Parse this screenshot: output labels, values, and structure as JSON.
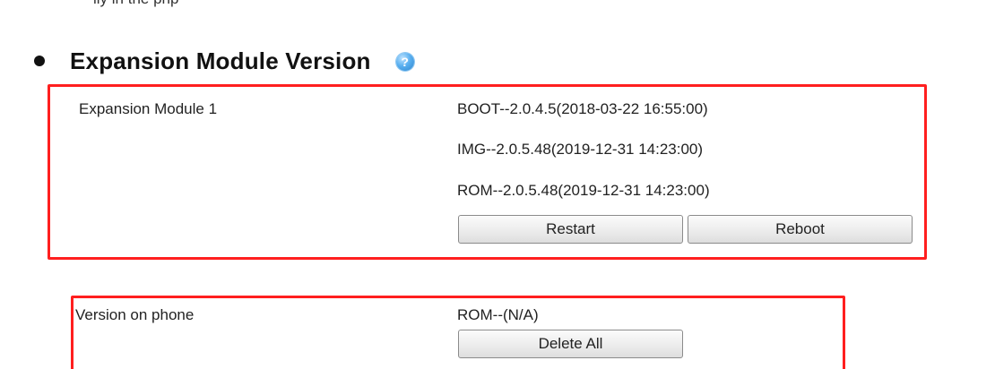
{
  "top_partial_text": "lly in the php",
  "section": {
    "title": "Expansion Module Version",
    "help_glyph": "?"
  },
  "module": {
    "label": "Expansion Module 1",
    "versions": [
      "BOOT--2.0.4.5(2018-03-22 16:55:00)",
      "IMG--2.0.5.48(2019-12-31 14:23:00)",
      "ROM--2.0.5.48(2019-12-31 14:23:00)"
    ],
    "restart_label": "Restart",
    "reboot_label": "Reboot"
  },
  "phone": {
    "label": "Version on phone",
    "version": "ROM--(N/A)",
    "delete_all_label": "Delete All"
  },
  "colors": {
    "highlight_border": "#ff1f1f",
    "help_icon": "#2f86cf"
  },
  "icons": {
    "bullet": "bullet-icon",
    "help": "help-icon"
  }
}
